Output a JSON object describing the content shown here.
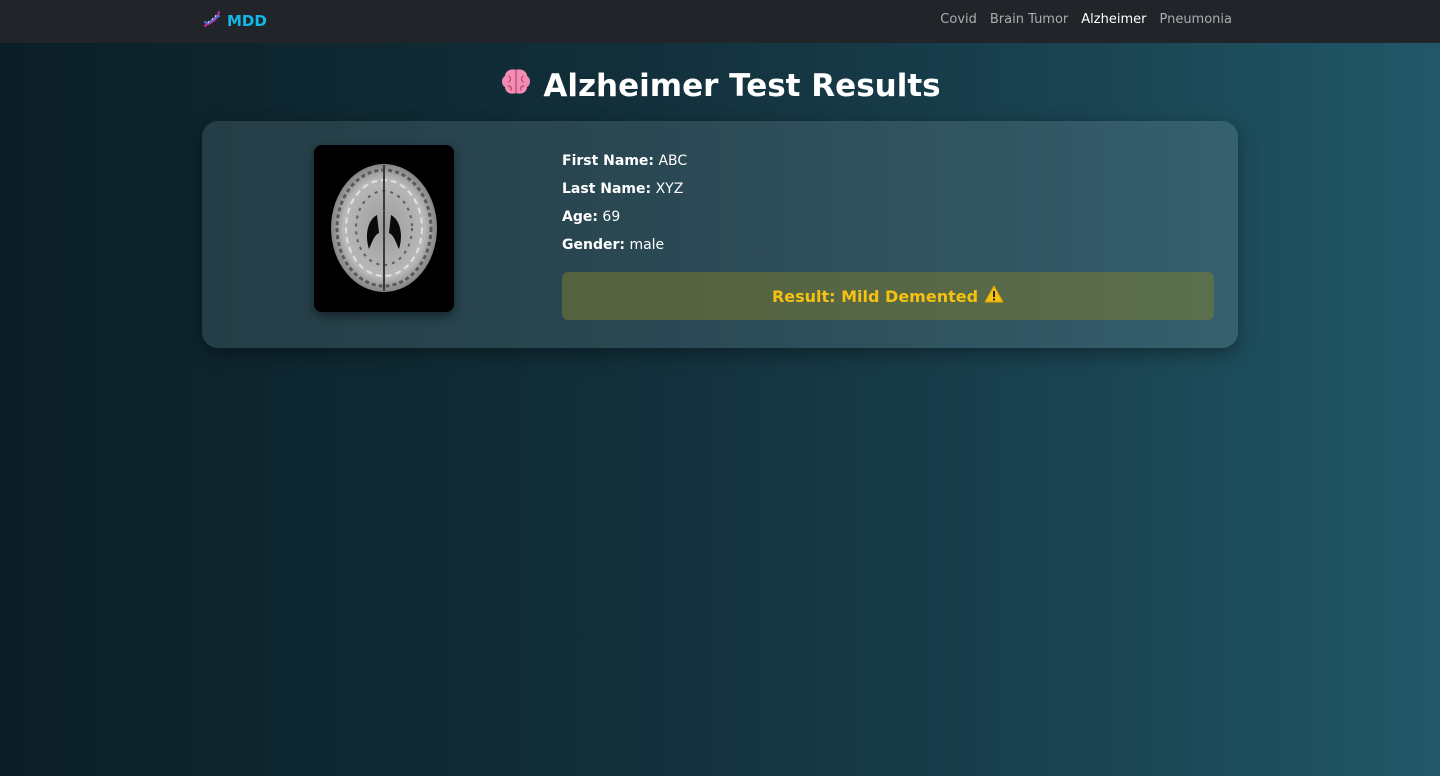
{
  "navbar": {
    "brand": "MDD",
    "links": [
      {
        "label": "Covid",
        "active": false
      },
      {
        "label": "Brain Tumor",
        "active": false
      },
      {
        "label": "Alzheimer",
        "active": true
      },
      {
        "label": "Pneumonia",
        "active": false
      }
    ]
  },
  "page": {
    "title": "Alzheimer Test Results",
    "title_icon": "brain-icon"
  },
  "patient": {
    "first_name_label": "First Name:",
    "first_name": "ABC",
    "last_name_label": "Last Name:",
    "last_name": "XYZ",
    "age_label": "Age:",
    "age": "69",
    "gender_label": "Gender:",
    "gender": "male"
  },
  "result": {
    "text": "Result: Mild Demented",
    "icon": "warning-icon",
    "color": "#f5c211"
  },
  "colors": {
    "brand": "#12b8e6",
    "navbar_bg": "#212529"
  }
}
